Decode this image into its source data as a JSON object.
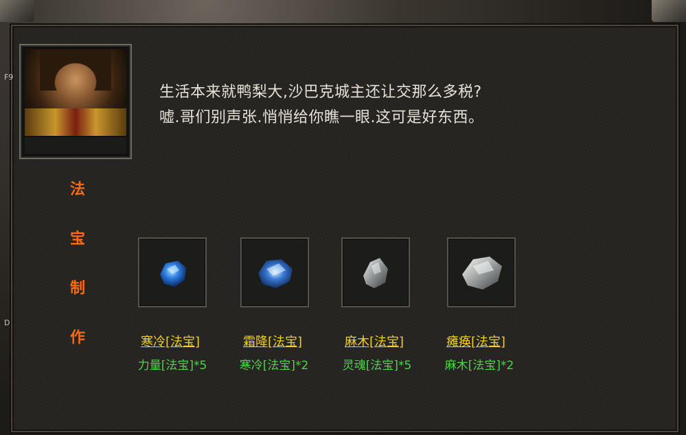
{
  "side_tags": {
    "top": "F9",
    "bottom": "D"
  },
  "dialog": {
    "line1": "生活本来就鸭梨大,沙巴克城主还让交那么多税?",
    "line2": "嘘.哥们别声张.悄悄给你瞧一眼.这可是好东西。"
  },
  "title_chars": [
    "法",
    "宝",
    "制",
    "作"
  ],
  "items": [
    {
      "name": "寒冷[法宝]",
      "requirement": "力量[法宝]*5",
      "icon": "blue-crystal-icon",
      "color": "#2f7fe0"
    },
    {
      "name": "霜降[法宝]",
      "requirement": "寒冷[法宝]*2",
      "icon": "blue-crystal-large-icon",
      "color": "#3a7ad6"
    },
    {
      "name": "麻木[法宝]",
      "requirement": "灵魂[法宝]*5",
      "icon": "grey-crystal-icon",
      "color": "#a9abab"
    },
    {
      "name": "瘫痪[法宝]",
      "requirement": "麻木[法宝]*2",
      "icon": "grey-crystal-large-icon",
      "color": "#b5b8b8"
    }
  ],
  "colors": {
    "title": "#ff6a10",
    "item_name": "#f3d21e",
    "item_requirement": "#4fd34a",
    "dialog_text": "#e6e2d8"
  }
}
